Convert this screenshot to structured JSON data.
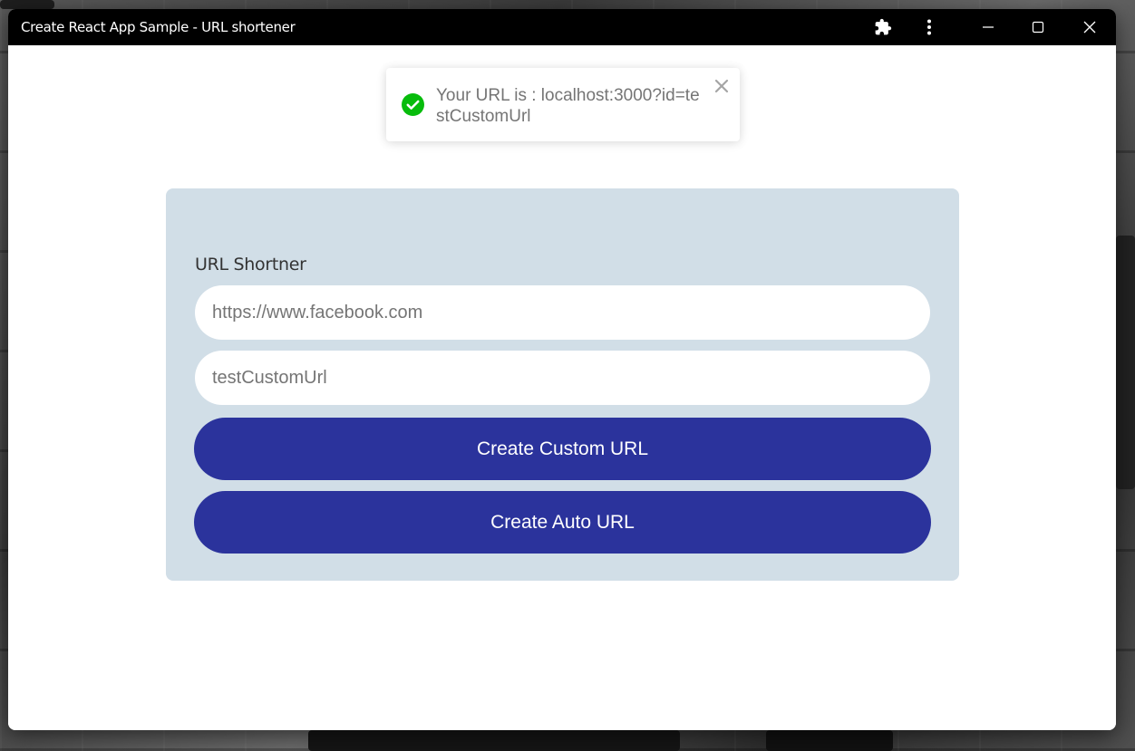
{
  "window": {
    "title": "Create React App Sample - URL shortener"
  },
  "titlebar_icons": {
    "extensions": "puzzle-icon",
    "more": "more-vertical-icon",
    "minimize": "minimize-icon",
    "maximize": "maximize-icon",
    "close": "close-icon"
  },
  "toast": {
    "message": "Your URL is : localhost:3000?id=testCustomUrl",
    "icon": "success-check-icon",
    "icon_color": "#07bc0c",
    "close_symbol": "✕"
  },
  "form": {
    "label": "URL Shortner",
    "url_input_value": "https://www.facebook.com",
    "custom_input_value": "testCustomUrl",
    "create_custom_button": "Create Custom URL",
    "create_auto_button": "Create Auto URL"
  },
  "colors": {
    "titlebar": "#000000",
    "card_background": "#d1dee7",
    "button_background": "#2b339c",
    "button_text": "#ffffff"
  }
}
